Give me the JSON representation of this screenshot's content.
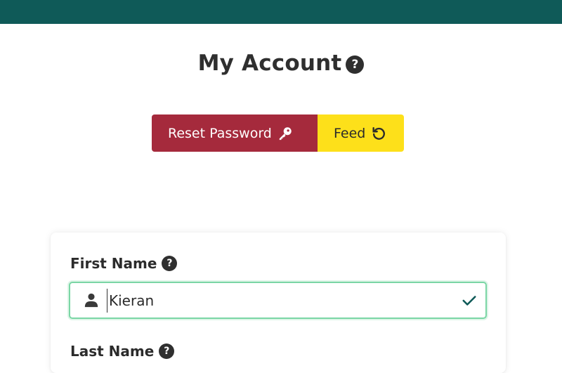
{
  "header": {
    "title": "My Account",
    "help_glyph": "?"
  },
  "actions": {
    "reset_label": "Reset Password",
    "reset_icon": "key-icon",
    "reset_color": "#a52a3c",
    "feed_label": "Feed",
    "feed_icon": "undo-icon",
    "feed_color": "#fde01a"
  },
  "form": {
    "first_name": {
      "label": "First Name",
      "value": "Kieran",
      "icon": "user-icon",
      "status": "valid",
      "help_glyph": "?"
    },
    "last_name": {
      "label": "Last Name",
      "help_glyph": "?"
    }
  },
  "theme": {
    "topbar_color": "#0f5a58",
    "valid_border_color": "#7bd6a5",
    "check_color": "#0f5a58"
  }
}
